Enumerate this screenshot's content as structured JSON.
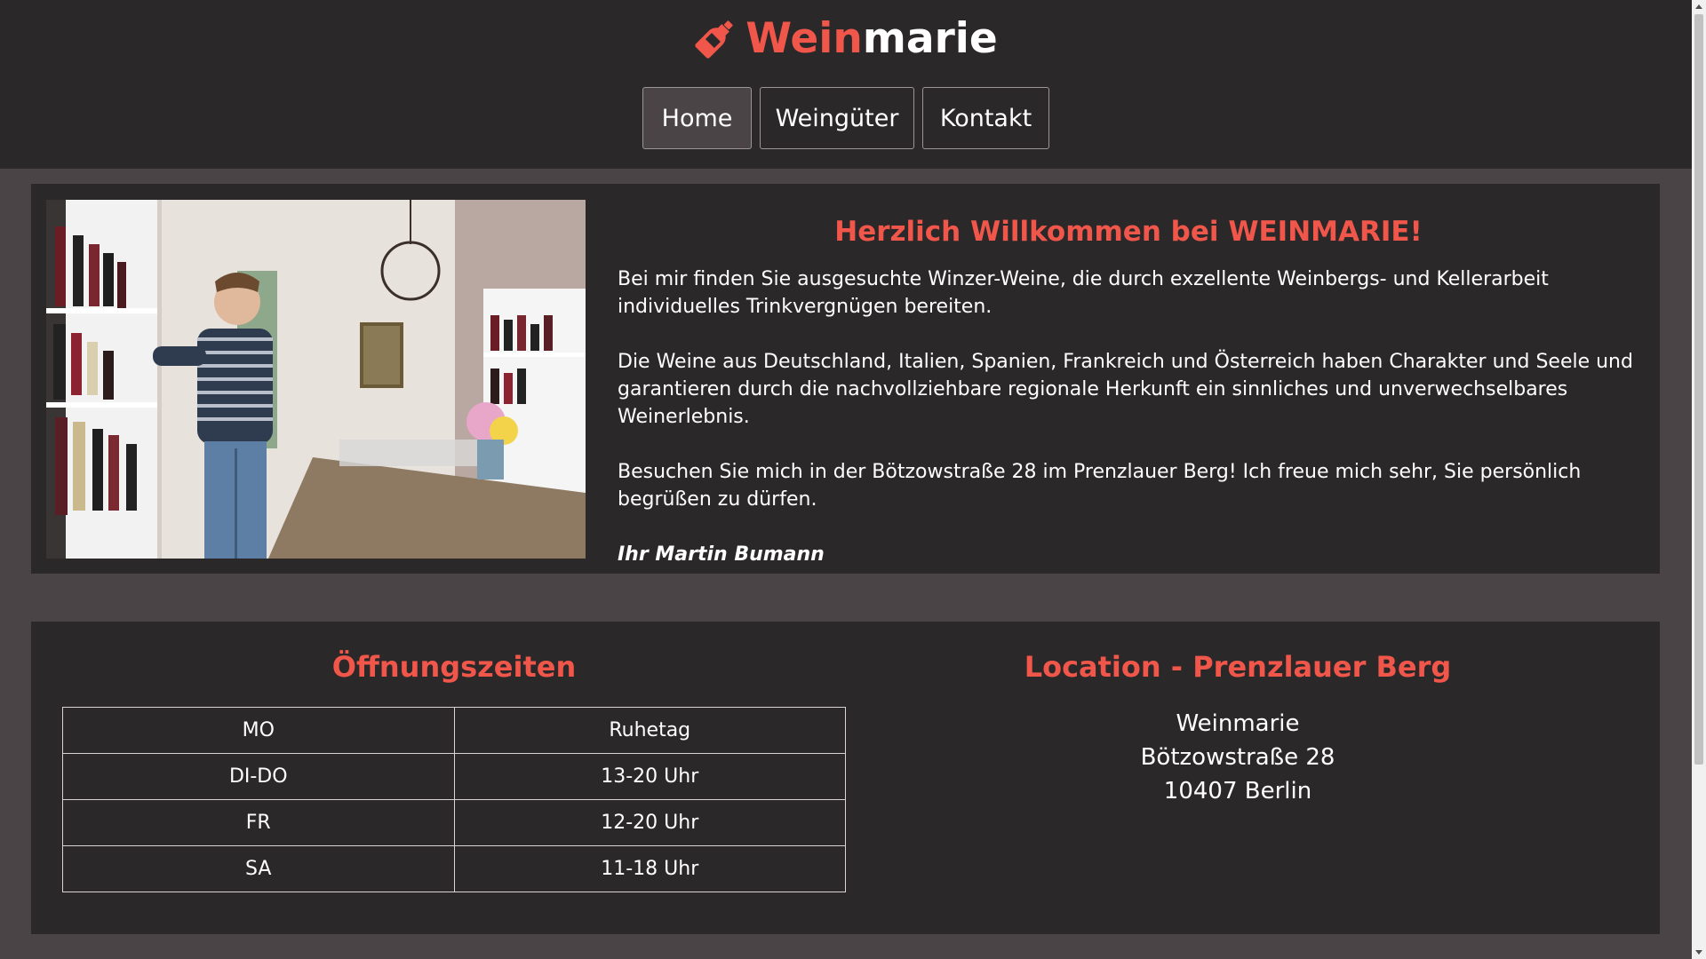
{
  "header": {
    "logo_part1": "Wein",
    "logo_part2": "marie",
    "logo_icon": "wine-bottle-icon",
    "nav": [
      {
        "label": "Home",
        "active": true
      },
      {
        "label": "Weingüter",
        "active": false
      },
      {
        "label": "Kontakt",
        "active": false
      }
    ]
  },
  "welcome": {
    "title": "Herzlich Willkommen bei WEINMARIE!",
    "paragraphs": [
      "Bei mir finden Sie ausgesuchte Winzer-Weine, die durch exzellente Weinbergs- und Kellerarbeit individuelles Trinkvergnügen bereiten.",
      "Die Weine aus Deutschland, Italien, Spanien, Frankreich und Österreich haben Charakter und Seele und garantieren durch die nachvollziehbare regionale Herkunft ein sinnliches und unverwechselbares Weinerlebnis.",
      "Besuchen Sie mich in der Bötzowstraße 28 im Prenzlauer Berg! Ich freue mich sehr, Sie persönlich begrüßen zu dürfen."
    ],
    "signature": "Ihr Martin Bumann"
  },
  "hours": {
    "title": "Öffnungszeiten",
    "rows": [
      {
        "day": "MO",
        "time": "Ruhetag"
      },
      {
        "day": "DI-DO",
        "time": "13-20 Uhr"
      },
      {
        "day": "FR",
        "time": "12-20 Uhr"
      },
      {
        "day": "SA",
        "time": "11-18 Uhr"
      }
    ]
  },
  "location": {
    "title": "Location - Prenzlauer Berg",
    "name": "Weinmarie",
    "street": "Bötzowstraße 28",
    "city": "10407 Berlin"
  },
  "colors": {
    "accent": "#f0564a",
    "panel": "#2b2829",
    "background": "#4a4446"
  }
}
